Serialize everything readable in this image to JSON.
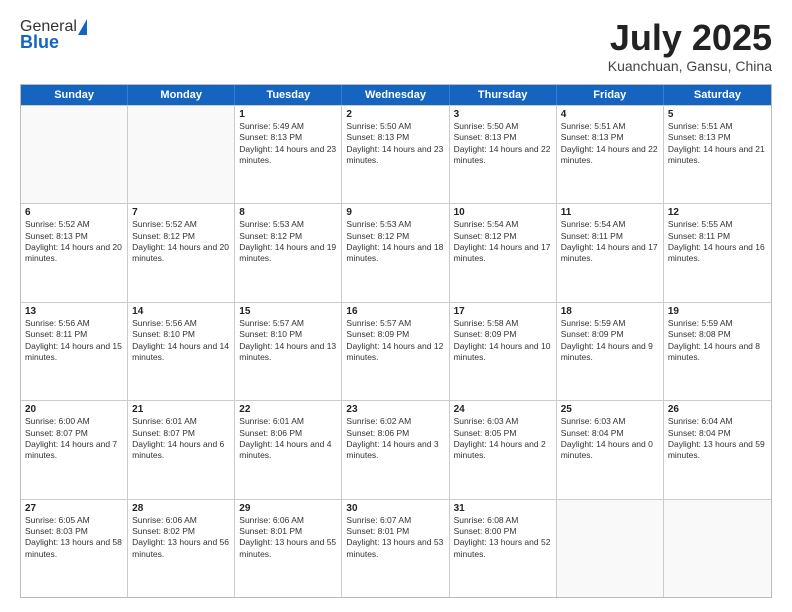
{
  "header": {
    "logo_general": "General",
    "logo_blue": "Blue",
    "title": "July 2025",
    "location": "Kuanchuan, Gansu, China"
  },
  "days_of_week": [
    "Sunday",
    "Monday",
    "Tuesday",
    "Wednesday",
    "Thursday",
    "Friday",
    "Saturday"
  ],
  "weeks": [
    [
      {
        "day": "",
        "sunrise": "",
        "sunset": "",
        "daylight": ""
      },
      {
        "day": "",
        "sunrise": "",
        "sunset": "",
        "daylight": ""
      },
      {
        "day": "1",
        "sunrise": "Sunrise: 5:49 AM",
        "sunset": "Sunset: 8:13 PM",
        "daylight": "Daylight: 14 hours and 23 minutes."
      },
      {
        "day": "2",
        "sunrise": "Sunrise: 5:50 AM",
        "sunset": "Sunset: 8:13 PM",
        "daylight": "Daylight: 14 hours and 23 minutes."
      },
      {
        "day": "3",
        "sunrise": "Sunrise: 5:50 AM",
        "sunset": "Sunset: 8:13 PM",
        "daylight": "Daylight: 14 hours and 22 minutes."
      },
      {
        "day": "4",
        "sunrise": "Sunrise: 5:51 AM",
        "sunset": "Sunset: 8:13 PM",
        "daylight": "Daylight: 14 hours and 22 minutes."
      },
      {
        "day": "5",
        "sunrise": "Sunrise: 5:51 AM",
        "sunset": "Sunset: 8:13 PM",
        "daylight": "Daylight: 14 hours and 21 minutes."
      }
    ],
    [
      {
        "day": "6",
        "sunrise": "Sunrise: 5:52 AM",
        "sunset": "Sunset: 8:13 PM",
        "daylight": "Daylight: 14 hours and 20 minutes."
      },
      {
        "day": "7",
        "sunrise": "Sunrise: 5:52 AM",
        "sunset": "Sunset: 8:12 PM",
        "daylight": "Daylight: 14 hours and 20 minutes."
      },
      {
        "day": "8",
        "sunrise": "Sunrise: 5:53 AM",
        "sunset": "Sunset: 8:12 PM",
        "daylight": "Daylight: 14 hours and 19 minutes."
      },
      {
        "day": "9",
        "sunrise": "Sunrise: 5:53 AM",
        "sunset": "Sunset: 8:12 PM",
        "daylight": "Daylight: 14 hours and 18 minutes."
      },
      {
        "day": "10",
        "sunrise": "Sunrise: 5:54 AM",
        "sunset": "Sunset: 8:12 PM",
        "daylight": "Daylight: 14 hours and 17 minutes."
      },
      {
        "day": "11",
        "sunrise": "Sunrise: 5:54 AM",
        "sunset": "Sunset: 8:11 PM",
        "daylight": "Daylight: 14 hours and 17 minutes."
      },
      {
        "day": "12",
        "sunrise": "Sunrise: 5:55 AM",
        "sunset": "Sunset: 8:11 PM",
        "daylight": "Daylight: 14 hours and 16 minutes."
      }
    ],
    [
      {
        "day": "13",
        "sunrise": "Sunrise: 5:56 AM",
        "sunset": "Sunset: 8:11 PM",
        "daylight": "Daylight: 14 hours and 15 minutes."
      },
      {
        "day": "14",
        "sunrise": "Sunrise: 5:56 AM",
        "sunset": "Sunset: 8:10 PM",
        "daylight": "Daylight: 14 hours and 14 minutes."
      },
      {
        "day": "15",
        "sunrise": "Sunrise: 5:57 AM",
        "sunset": "Sunset: 8:10 PM",
        "daylight": "Daylight: 14 hours and 13 minutes."
      },
      {
        "day": "16",
        "sunrise": "Sunrise: 5:57 AM",
        "sunset": "Sunset: 8:09 PM",
        "daylight": "Daylight: 14 hours and 12 minutes."
      },
      {
        "day": "17",
        "sunrise": "Sunrise: 5:58 AM",
        "sunset": "Sunset: 8:09 PM",
        "daylight": "Daylight: 14 hours and 10 minutes."
      },
      {
        "day": "18",
        "sunrise": "Sunrise: 5:59 AM",
        "sunset": "Sunset: 8:09 PM",
        "daylight": "Daylight: 14 hours and 9 minutes."
      },
      {
        "day": "19",
        "sunrise": "Sunrise: 5:59 AM",
        "sunset": "Sunset: 8:08 PM",
        "daylight": "Daylight: 14 hours and 8 minutes."
      }
    ],
    [
      {
        "day": "20",
        "sunrise": "Sunrise: 6:00 AM",
        "sunset": "Sunset: 8:07 PM",
        "daylight": "Daylight: 14 hours and 7 minutes."
      },
      {
        "day": "21",
        "sunrise": "Sunrise: 6:01 AM",
        "sunset": "Sunset: 8:07 PM",
        "daylight": "Daylight: 14 hours and 6 minutes."
      },
      {
        "day": "22",
        "sunrise": "Sunrise: 6:01 AM",
        "sunset": "Sunset: 8:06 PM",
        "daylight": "Daylight: 14 hours and 4 minutes."
      },
      {
        "day": "23",
        "sunrise": "Sunrise: 6:02 AM",
        "sunset": "Sunset: 8:06 PM",
        "daylight": "Daylight: 14 hours and 3 minutes."
      },
      {
        "day": "24",
        "sunrise": "Sunrise: 6:03 AM",
        "sunset": "Sunset: 8:05 PM",
        "daylight": "Daylight: 14 hours and 2 minutes."
      },
      {
        "day": "25",
        "sunrise": "Sunrise: 6:03 AM",
        "sunset": "Sunset: 8:04 PM",
        "daylight": "Daylight: 14 hours and 0 minutes."
      },
      {
        "day": "26",
        "sunrise": "Sunrise: 6:04 AM",
        "sunset": "Sunset: 8:04 PM",
        "daylight": "Daylight: 13 hours and 59 minutes."
      }
    ],
    [
      {
        "day": "27",
        "sunrise": "Sunrise: 6:05 AM",
        "sunset": "Sunset: 8:03 PM",
        "daylight": "Daylight: 13 hours and 58 minutes."
      },
      {
        "day": "28",
        "sunrise": "Sunrise: 6:06 AM",
        "sunset": "Sunset: 8:02 PM",
        "daylight": "Daylight: 13 hours and 56 minutes."
      },
      {
        "day": "29",
        "sunrise": "Sunrise: 6:06 AM",
        "sunset": "Sunset: 8:01 PM",
        "daylight": "Daylight: 13 hours and 55 minutes."
      },
      {
        "day": "30",
        "sunrise": "Sunrise: 6:07 AM",
        "sunset": "Sunset: 8:01 PM",
        "daylight": "Daylight: 13 hours and 53 minutes."
      },
      {
        "day": "31",
        "sunrise": "Sunrise: 6:08 AM",
        "sunset": "Sunset: 8:00 PM",
        "daylight": "Daylight: 13 hours and 52 minutes."
      },
      {
        "day": "",
        "sunrise": "",
        "sunset": "",
        "daylight": ""
      },
      {
        "day": "",
        "sunrise": "",
        "sunset": "",
        "daylight": ""
      }
    ]
  ]
}
